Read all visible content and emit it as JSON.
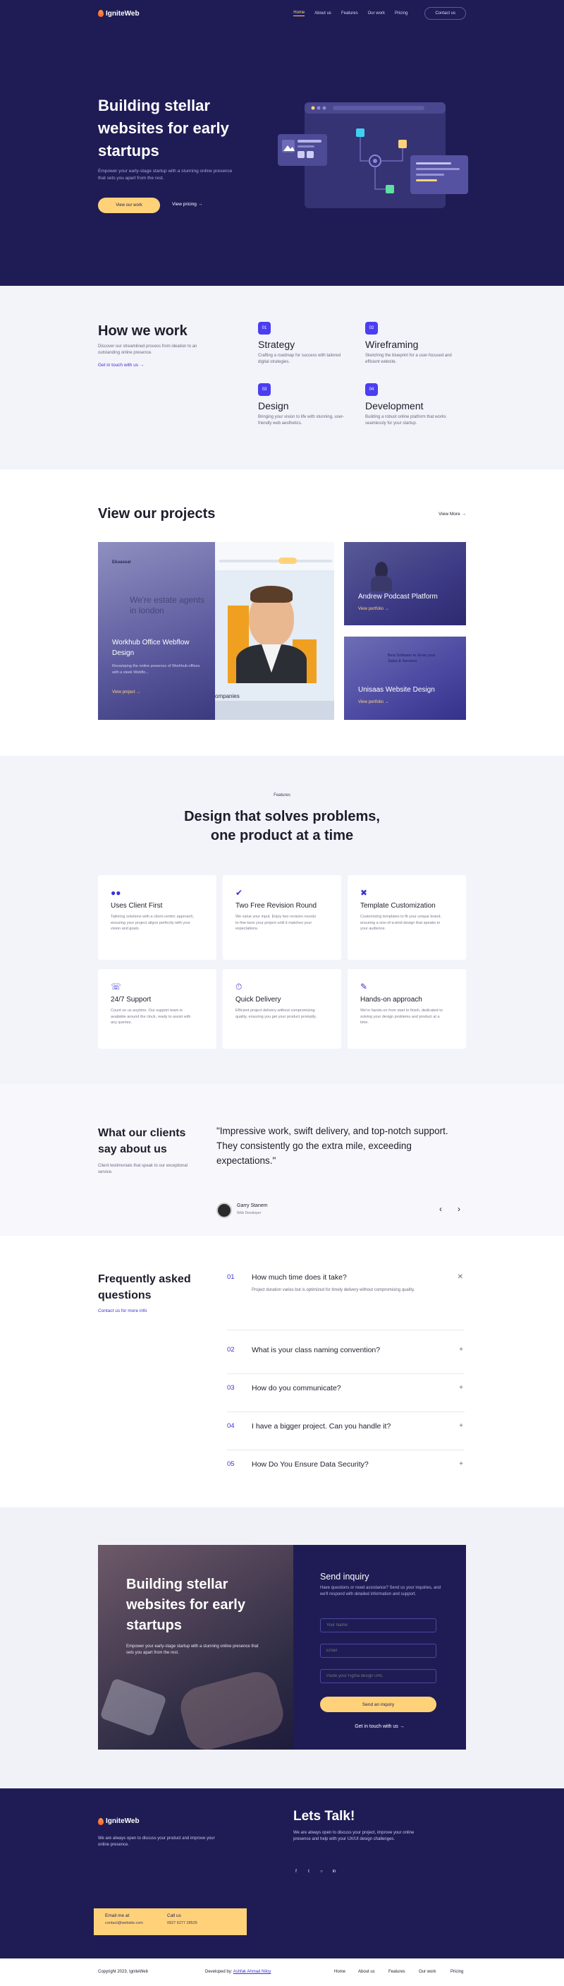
{
  "brand": {
    "name": "IgniteWeb"
  },
  "nav": {
    "links": [
      "Home",
      "About us",
      "Features",
      "Our work",
      "Pricing"
    ],
    "contact": "Contact us"
  },
  "hero": {
    "title": "Building stellar websites for early startups",
    "subtitle": "Empower your early-stage startup with a stunning online presence that sets you apart from the rest.",
    "cta": "View our work",
    "link": "View pricing"
  },
  "how": {
    "title": "How we work",
    "subtitle": "Discover our streamlined process from ideation to an outstanding online presence.",
    "link": "Get in touch with us",
    "steps": [
      {
        "num": "01",
        "title": "Strategy",
        "desc": "Crafting a roadmap for success with tailored digital strategies."
      },
      {
        "num": "02",
        "title": "Wireframing",
        "desc": "Sketching the blueprint for a user-focused and efficient website."
      },
      {
        "num": "03",
        "title": "Design",
        "desc": "Bringing your vision to life with stunning, user-friendly web aesthetics."
      },
      {
        "num": "04",
        "title": "Development",
        "desc": "Building a robust online platform that works seamlessly for your startup."
      }
    ]
  },
  "projects": {
    "title": "View our projects",
    "view_more": "View More",
    "items": [
      {
        "title": "Workhub Office Webflow Design",
        "desc": "Revamping the online presence of Workhub offices with a sleek Webflo...",
        "link": "View project",
        "bg_text": "We're estate agents in london",
        "bg_logo": "Ekuasoal",
        "bg_caption": "ompanies"
      },
      {
        "title": "Andrew Podcast Platform",
        "link": "View portfolio"
      },
      {
        "title": "Unisaas Website Design",
        "link": "View portfolio",
        "bg_text": "Best Software to Grow your Sales & Services"
      }
    ]
  },
  "features": {
    "eyebrow": "Features",
    "title": "Design that solves problems, one product at a time",
    "cards": [
      {
        "icon": "users-icon",
        "title": "Uses Client First",
        "desc": "Tailoring solutions with a client-centric approach, ensuring your project aligns perfectly with your vision and goals."
      },
      {
        "icon": "check-badge-icon",
        "title": "Two Free Revision Round",
        "desc": "We value your input. Enjoy two revision rounds to fine-tune your project until it matches your expectations."
      },
      {
        "icon": "tools-icon",
        "title": "Template Customization",
        "desc": "Customizing templates to fit your unique brand, ensuring a one-of-a-kind design that speaks to your audience."
      },
      {
        "icon": "support-icon",
        "title": "24/7 Support",
        "desc": "Count on us anytime. Our support team is available around the clock, ready to assist with any queries."
      },
      {
        "icon": "stopwatch-icon",
        "title": "Quick Delivery",
        "desc": "Efficient project delivery without compromising quality, ensuring you get your product promptly."
      },
      {
        "icon": "hands-on-icon",
        "title": "Hands-on approach",
        "desc": "We're hands-on from start to finish, dedicated to solving your design problems and product at a time."
      }
    ]
  },
  "testimonial": {
    "title": "What our clients say about us",
    "subtitle": "Client testimonials that speak to our exceptional service.",
    "quote": "\"Impressive work, swift delivery, and top-notch support. They consistently go the extra mile, exceeding expectations.\"",
    "author": "Garry Stanem",
    "role": "Web Developer"
  },
  "faq": {
    "title": "Frequently asked questions",
    "link": "Contact us for more info",
    "items": [
      {
        "num": "01",
        "q": "How much time does it take?",
        "a": "Project duration varies but is optimized for timely delivery without compromising quality."
      },
      {
        "num": "02",
        "q": "What is your class naming convention?"
      },
      {
        "num": "03",
        "q": "How do you communicate?"
      },
      {
        "num": "04",
        "q": "I have a bigger project. Can you handle it?"
      },
      {
        "num": "05",
        "q": "How Do You Ensure Data Security?"
      }
    ]
  },
  "inquiry": {
    "title": "Building stellar websites for early startups",
    "subtitle": "Empower your early-stage startup with a stunning online presence that sets you apart from the rest.",
    "form_title": "Send inquiry",
    "form_sub": "Have questions or need assistance? Send us your inquiries, and we'll respond with detailed information and support.",
    "name_placeholder": "Your Name",
    "email_placeholder": "Email",
    "url_placeholder": "Paste your Figma design URL",
    "send": "Send an inquiry",
    "link": "Get in touch with us"
  },
  "footer": {
    "desc": "We are always open to discuss your product and improve your online presence.",
    "talk_title": "Lets Talk!",
    "talk_desc": "We are always open to discuss your project, improve your online presence and help with your UX/UI design challenges.",
    "email_label": "Email me at",
    "email": "contact@website.com",
    "call_label": "Call us",
    "phone": "0927 6277 28525",
    "copyright": "Copyright 2023, IgniteWeb",
    "developed_label": "Developed by:",
    "developer": "Ashfak Ahmad Niloy",
    "links": [
      "Home",
      "About us",
      "Features",
      "Our work",
      "Pricing"
    ]
  },
  "colors": {
    "navy": "#1f1c55",
    "accent": "#ffd27a",
    "primary": "#3b32d6",
    "step_badge": "#4b3ef0"
  }
}
